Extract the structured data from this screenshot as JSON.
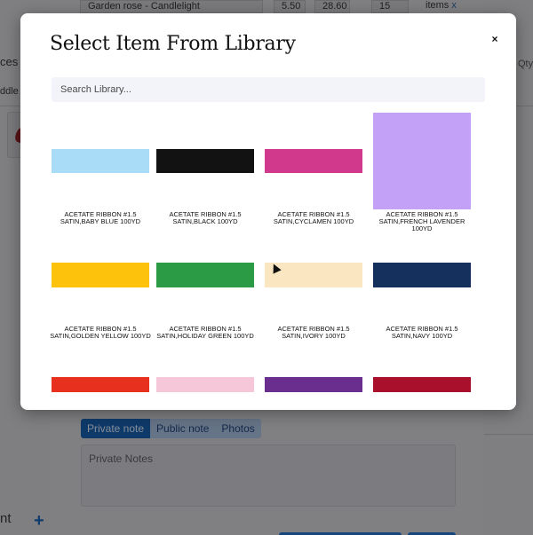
{
  "background": {
    "row": {
      "name": "Garden rose - Candlelight",
      "price": "5.50",
      "total": "28.60",
      "qty": "15",
      "unit": "items",
      "remove": "x"
    },
    "left_fragments": [
      "ces",
      "ddle",
      "nt"
    ],
    "right_fragment": "Qty",
    "note_tabs": [
      "Private note",
      "Public note",
      "Photos"
    ],
    "notes_placeholder": "Private Notes",
    "add_symbol": "+"
  },
  "modal": {
    "title": "Select Item From Library",
    "close": "×",
    "search_placeholder": "Search Library...",
    "items": [
      {
        "label": "ACETATE RIBBON #1.5 SATIN,BABY BLUE 100YD",
        "color": "#a9dcf6"
      },
      {
        "label": "ACETATE RIBBON #1.5 SATIN,BLACK 100YD",
        "color": "#121212"
      },
      {
        "label": "ACETATE RIBBON #1.5 SATIN,CYCLAMEN 100YD",
        "color": "#d13a8c"
      },
      {
        "label": "ACETATE RIBBON #1.5 SATIN,FRENCH LAVENDER 100YD",
        "color": "#c2a1f7"
      },
      {
        "label": "ACETATE RIBBON #1.5 SATIN,GOLDEN YELLOW 100YD",
        "color": "#fdc20b"
      },
      {
        "label": "ACETATE RIBBON #1.5 SATIN,HOLIDAY GREEN 100YD",
        "color": "#2b9b46"
      },
      {
        "label": "ACETATE RIBBON #1.5 SATIN,IVORY 100YD",
        "color": "#fbe6c2"
      },
      {
        "label": "ACETATE RIBBON #1.5 SATIN,NAVY 100YD",
        "color": "#16305e"
      },
      {
        "label": "",
        "color": "#e8301e"
      },
      {
        "label": "",
        "color": "#f6c7d9"
      },
      {
        "label": "",
        "color": "#6a2f8e"
      },
      {
        "label": "",
        "color": "#a8102b"
      }
    ]
  }
}
